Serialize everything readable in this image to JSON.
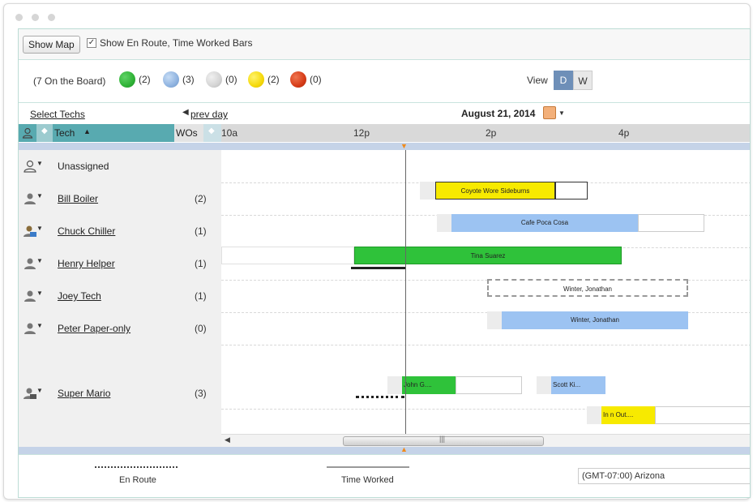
{
  "toolbar": {
    "show_map": "Show Map",
    "checkbox_label": "Show En Route, Time Worked Bars",
    "checkbox_mark": "✓"
  },
  "legend": {
    "on_board": "(7 On the Board)",
    "items": [
      {
        "color": "#2fb236",
        "count": "(2)"
      },
      {
        "color": "#8fb3e0",
        "count": "(3)"
      },
      {
        "color": "#d4d4d4",
        "count": "(0)"
      },
      {
        "color": "#f5d90a",
        "count": "(2)"
      },
      {
        "color": "#d63b17",
        "count": "(0)"
      }
    ],
    "view_label": "View",
    "view_day": "D",
    "view_week": "W"
  },
  "nav": {
    "select_techs": "Select Techs",
    "prev_day": "prev day",
    "date": "August 21, 2014"
  },
  "grid": {
    "tech_header": "Tech",
    "wos_header": "WOs",
    "times": [
      "10a",
      "12p",
      "2p",
      "4p"
    ]
  },
  "techs": [
    {
      "name": "Unassigned",
      "count": ""
    },
    {
      "name": "Bill Boiler",
      "count": "(2)"
    },
    {
      "name": "Chuck Chiller",
      "count": "(1)"
    },
    {
      "name": "Henry Helper",
      "count": "(1)"
    },
    {
      "name": "Joey Tech",
      "count": "(1)"
    },
    {
      "name": "Peter Paper-only",
      "count": "(0)"
    },
    {
      "name": "Super Mario",
      "count": "(3)"
    }
  ],
  "jobs": {
    "coyote": "Coyote Wore Sideburns",
    "cafe": "Cafe Poca Cosa",
    "tina": "Tina Suarez",
    "winter1": "Winter, Jonathan",
    "winter2": "Winter, Jonathan",
    "john": "John G....",
    "scott": "Scott Ki...",
    "innout": "In n Out...."
  },
  "footer": {
    "en_route": "En Route",
    "time_worked": "Time Worked",
    "timezone": "(GMT-07:00) Arizona"
  },
  "colors": {
    "green": "#2fb236",
    "blue": "#9cc3f2",
    "yellow": "#f7ea00",
    "teal": "#58aab0",
    "viewActive": "#6e8fb8"
  }
}
